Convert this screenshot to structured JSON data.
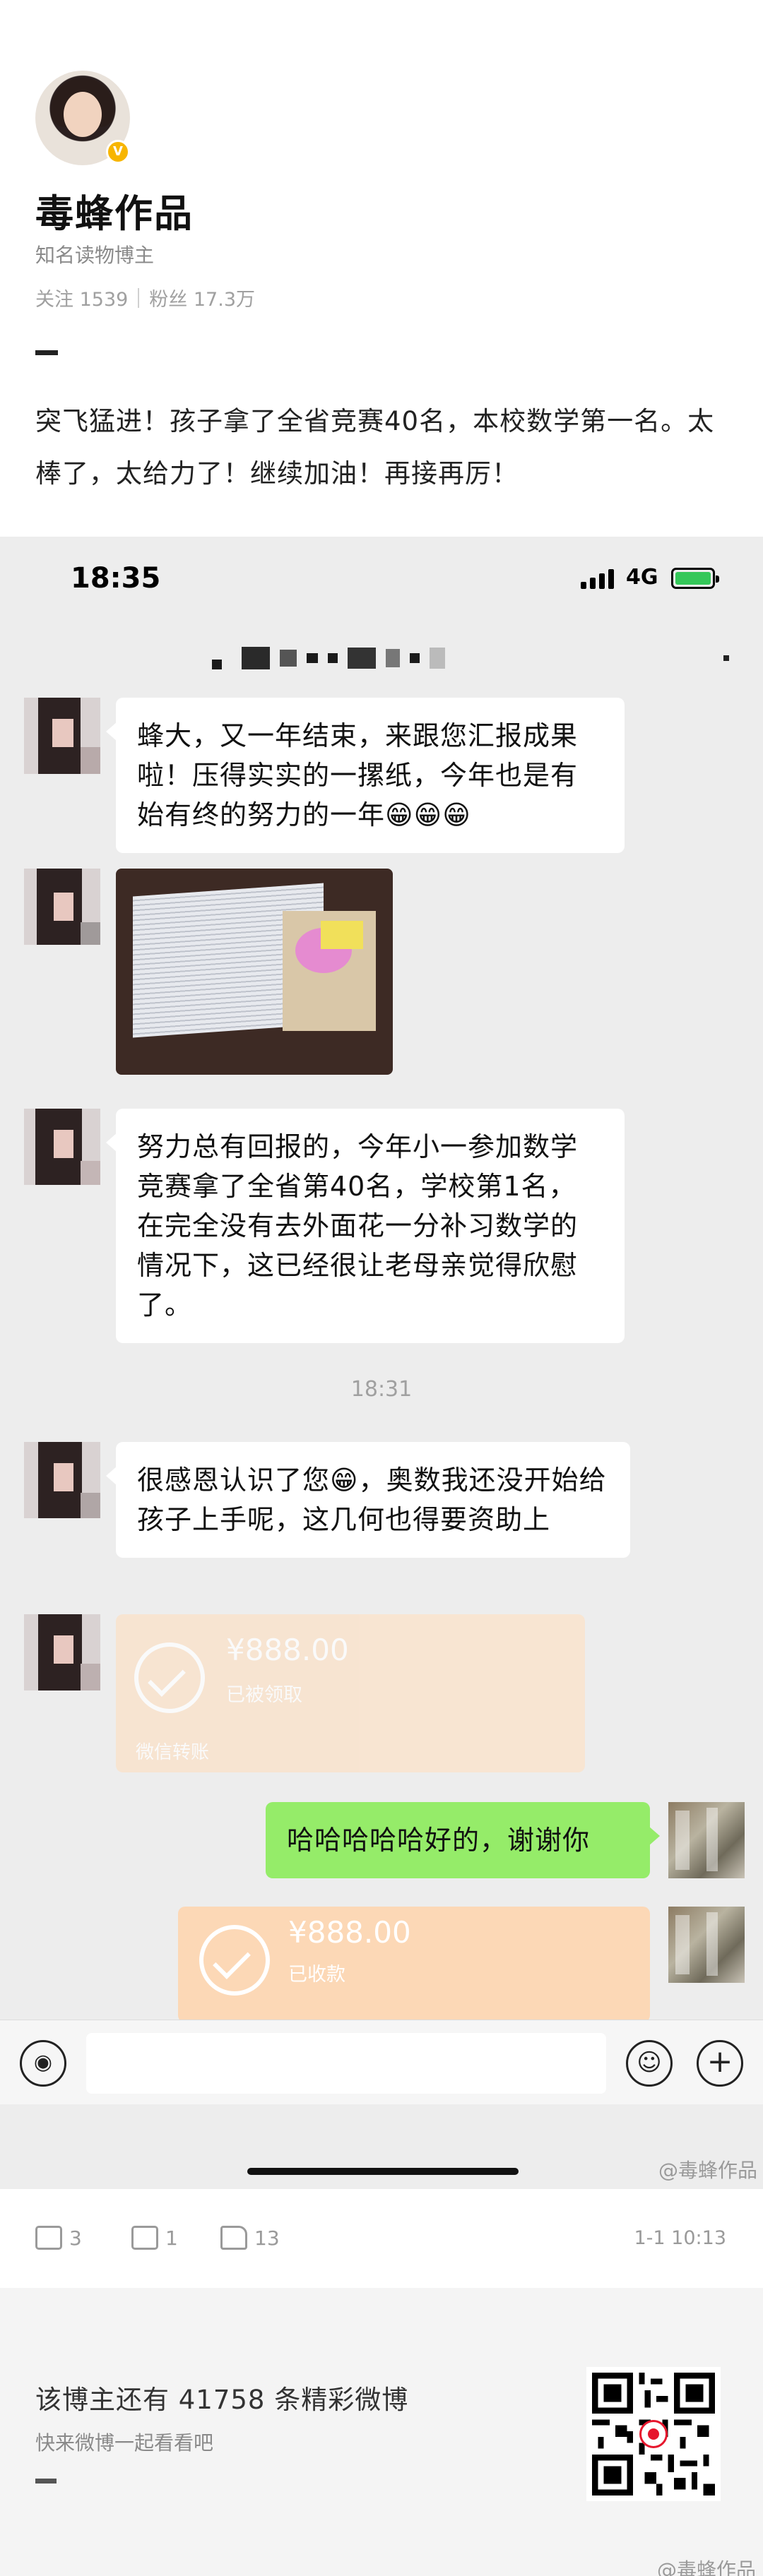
{
  "author": {
    "name": "毒蜂作品",
    "description": "知名读物博主",
    "follow_label": "关注 1539",
    "fans_label": "粉丝 17.3万"
  },
  "post": {
    "text": "突飞猛进！孩子拿了全省竞赛40名，本校数学第一名。太棒了，太给力了！继续加油！再接再厉！"
  },
  "screenshot": {
    "status_time": "18:35",
    "network": "4G",
    "messages": [
      {
        "text": "蜂大，又一年结束，来跟您汇报成果啦！压得实实的一摞纸，今年也是有始有终的努力的一年😁😁😁"
      },
      {
        "text": "努力总有回报的，今年小一参加数学竞赛拿了全省第40名，学校第1名，在完全没有去外面花一分补习数学的情况下，这已经很让老母亲觉得欣慰了。"
      },
      {
        "text": "很感恩认识了您😁，奥数我还没开始给孩子上手呢，这几何也得要资助上"
      }
    ],
    "timestamp": "18:31",
    "transfer_received": {
      "amount": "¥888.00",
      "status": "已被领取",
      "footer": "微信转账"
    },
    "reply": {
      "text": "哈哈哈哈哈好的，谢谢你"
    },
    "transfer_sent": {
      "amount": "¥888.00",
      "status": "已收款"
    },
    "watermark": "@毒蜂作品"
  },
  "actions": {
    "repost_count": "3",
    "comment_count": "1",
    "like_count": "13",
    "date": "1-1 10:13"
  },
  "promo": {
    "title": "该博主还有 41758 条精彩微博",
    "subtitle": "快来微博一起看看吧",
    "watermark": "@毒蜂作品"
  }
}
